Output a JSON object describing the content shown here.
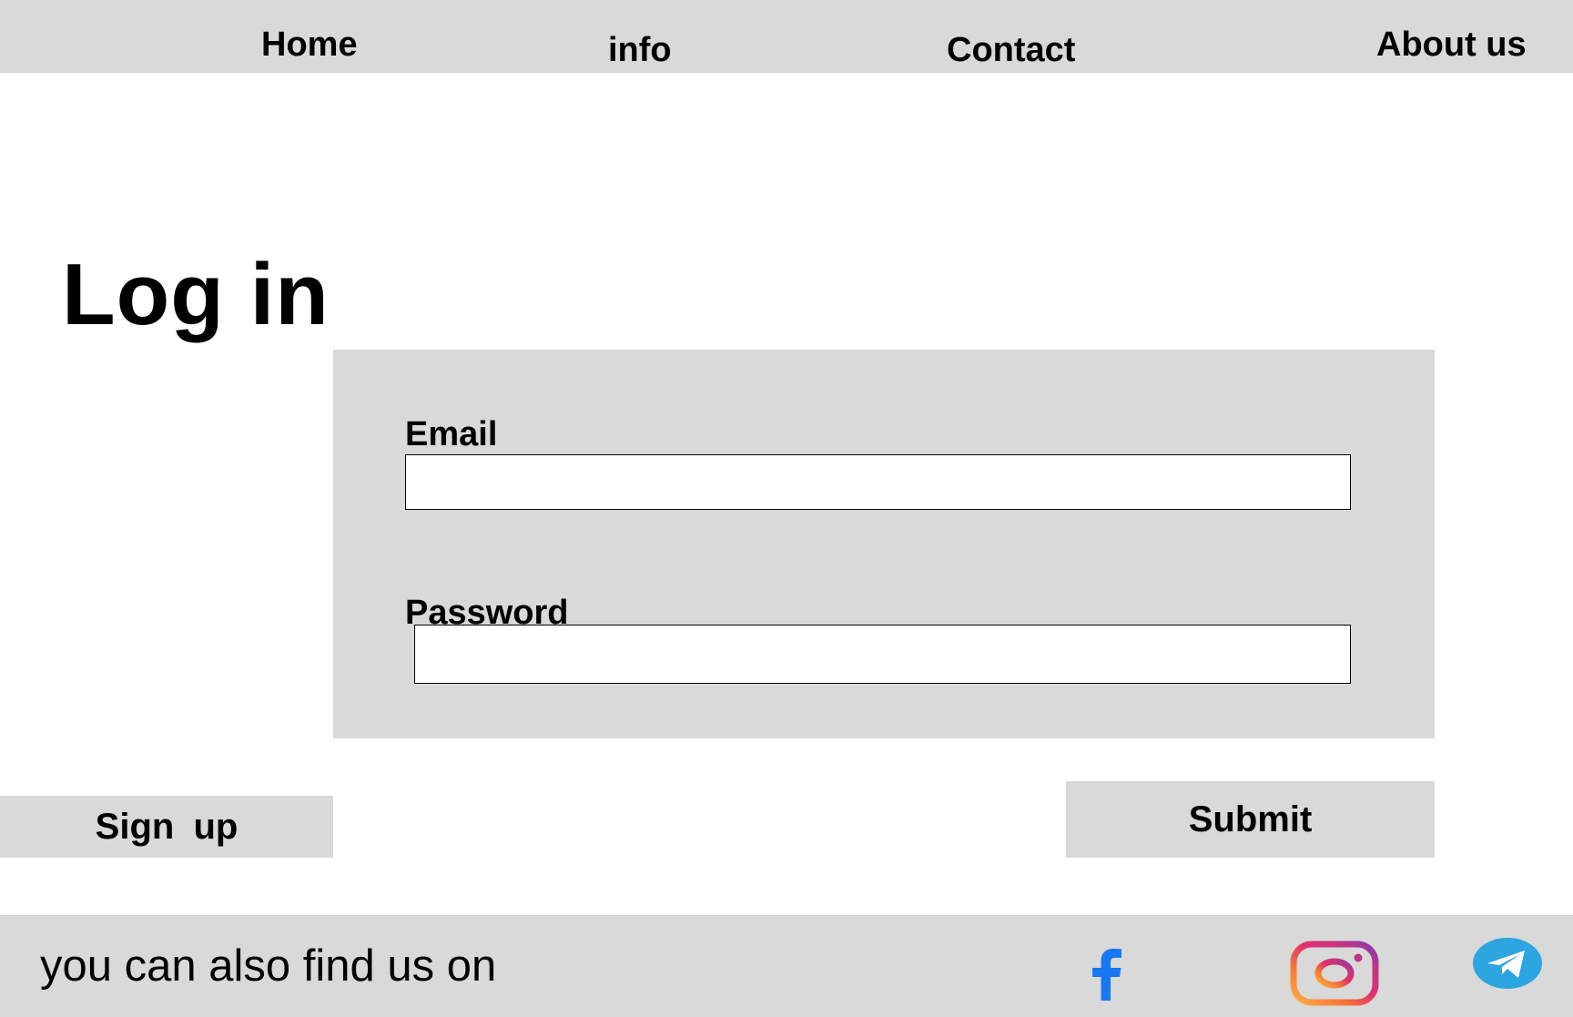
{
  "nav": {
    "items": [
      {
        "label": "Home"
      },
      {
        "label": "info"
      },
      {
        "label": "Contact"
      },
      {
        "label": "About us"
      }
    ]
  },
  "page": {
    "title": "Log in"
  },
  "form": {
    "email": {
      "label": "Email",
      "value": "",
      "placeholder": ""
    },
    "password": {
      "label": "Password",
      "value": "",
      "placeholder": ""
    }
  },
  "buttons": {
    "signup_label": "Sign  up",
    "submit_label": "Submit"
  },
  "footer": {
    "text": "you can also find us on",
    "social": [
      {
        "icon": "facebook-icon",
        "color": "#1877f2"
      },
      {
        "icon": "instagram-icon",
        "colors": [
          "#833ab4",
          "#e1306c",
          "#fd1d1d",
          "#f77737",
          "#fcaf45"
        ]
      },
      {
        "icon": "telegram-icon",
        "color": "#2ca5e0"
      }
    ]
  },
  "colors": {
    "panel": "#d9d9d9",
    "background": "#ffffff",
    "text": "#000000"
  }
}
